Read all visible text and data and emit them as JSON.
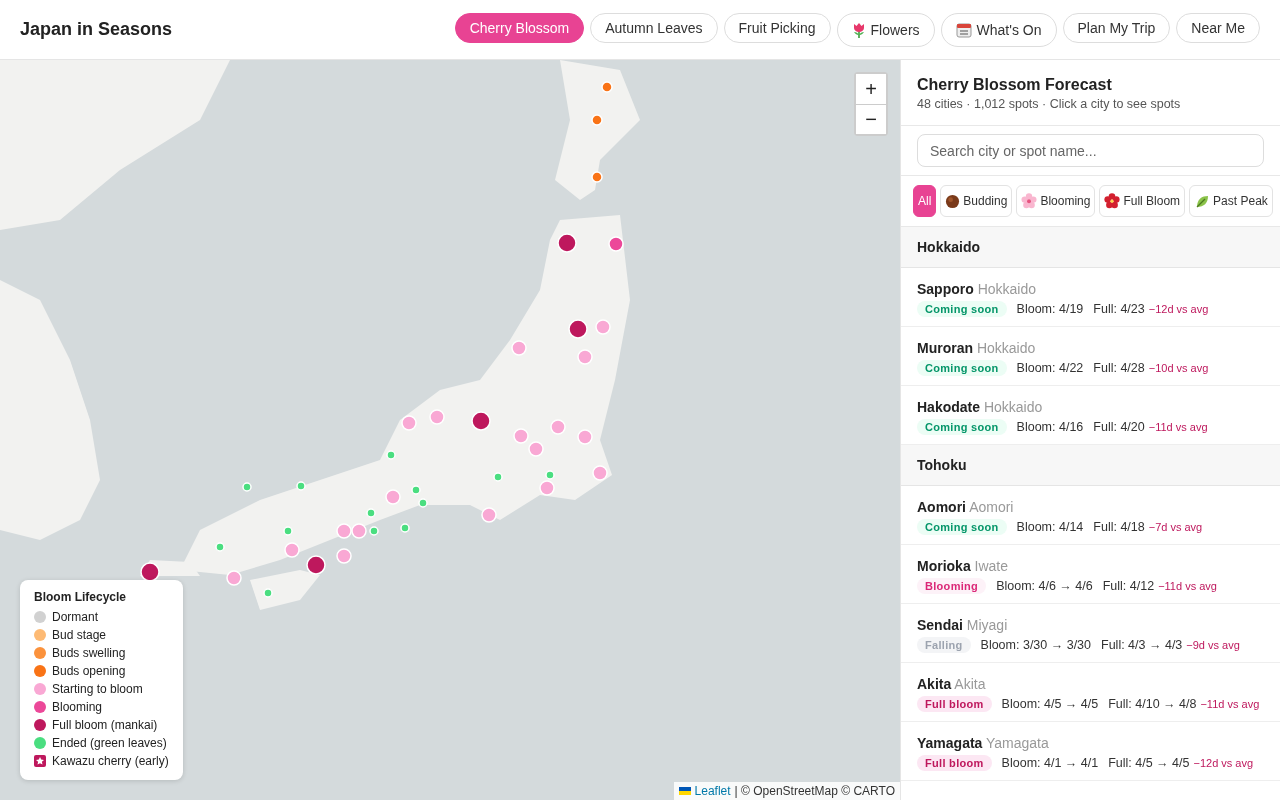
{
  "header": {
    "title": "Japan in Seasons",
    "nav": [
      {
        "label": "Cherry Blossom",
        "selected": true,
        "kind": "plain"
      },
      {
        "label": "Autumn Leaves",
        "selected": false,
        "kind": "plain"
      },
      {
        "label": "Fruit Picking",
        "selected": false,
        "kind": "plain"
      },
      {
        "label": "Flowers",
        "selected": false,
        "kind": "tulip"
      },
      {
        "label": "What's On",
        "selected": false,
        "kind": "calendar"
      },
      {
        "label": "Plan My Trip",
        "selected": false,
        "kind": "plain"
      },
      {
        "label": "Near Me",
        "selected": false,
        "kind": "plain"
      }
    ]
  },
  "map": {
    "zoom_in": "+",
    "zoom_out": "−",
    "legend": {
      "title": "Bloom Lifecycle",
      "items": [
        {
          "label": "Dormant",
          "color": "#d1d1d1",
          "kind": "dot"
        },
        {
          "label": "Bud stage",
          "color": "#fdba74",
          "kind": "dot"
        },
        {
          "label": "Buds swelling",
          "color": "#fb923c",
          "kind": "dot"
        },
        {
          "label": "Buds opening",
          "color": "#f97316",
          "kind": "dot"
        },
        {
          "label": "Starting to bloom",
          "color": "#f9a8d4",
          "kind": "dot"
        },
        {
          "label": "Blooming",
          "color": "#ec4899",
          "kind": "dot"
        },
        {
          "label": "Full bloom (mankai)",
          "color": "#be185d",
          "kind": "dot"
        },
        {
          "label": "Ended (green leaves)",
          "color": "#4ade80",
          "kind": "dot"
        },
        {
          "label": "Kawazu cherry (early)",
          "color": "#be185d",
          "kind": "star"
        }
      ]
    },
    "attribution": {
      "link": "Leaflet",
      "text": "| © OpenStreetMap © CARTO"
    }
  },
  "sidebar": {
    "title": "Cherry Blossom Forecast",
    "subtitle": "48 cities · 1,012 spots · Click a city to see spots",
    "search": {
      "placeholder": "Search city or spot name..."
    },
    "filters": [
      {
        "label": "All",
        "selected": true,
        "kind": "plain"
      },
      {
        "label": "Budding",
        "selected": false,
        "kind": "bud"
      },
      {
        "label": "Blooming",
        "selected": false,
        "kind": "blossom"
      },
      {
        "label": "Full Bloom",
        "selected": false,
        "kind": "hibiscus"
      },
      {
        "label": "Past Peak",
        "selected": false,
        "kind": "leaf"
      }
    ],
    "regions": [
      {
        "name": "Hokkaido",
        "cities": [
          {
            "city": "Sapporo",
            "prefecture": "Hokkaido",
            "status": "Coming soon",
            "kind": "soon",
            "bloom": "Bloom: 4/19",
            "full": "Full: 4/23",
            "diff": "−12d vs avg"
          },
          {
            "city": "Muroran",
            "prefecture": "Hokkaido",
            "status": "Coming soon",
            "kind": "soon",
            "bloom": "Bloom: 4/22",
            "full": "Full: 4/28",
            "diff": "−10d vs avg"
          },
          {
            "city": "Hakodate",
            "prefecture": "Hokkaido",
            "status": "Coming soon",
            "kind": "soon",
            "bloom": "Bloom: 4/16",
            "full": "Full: 4/20",
            "diff": "−11d vs avg"
          }
        ]
      },
      {
        "name": "Tohoku",
        "cities": [
          {
            "city": "Aomori",
            "prefecture": "Aomori",
            "status": "Coming soon",
            "kind": "soon",
            "bloom": "Bloom: 4/14",
            "full": "Full: 4/18",
            "diff": "−7d vs avg"
          },
          {
            "city": "Morioka",
            "prefecture": "Iwate",
            "status": "Blooming",
            "kind": "blooming",
            "bloom": "Bloom: 4/6 → 4/6",
            "full": "Full: 4/12",
            "diff": "−11d vs avg"
          },
          {
            "city": "Sendai",
            "prefecture": "Miyagi",
            "status": "Falling",
            "kind": "falling",
            "bloom": "Bloom: 3/30 → 3/30",
            "full": "Full: 4/3 → 4/3",
            "diff": "−9d vs avg"
          },
          {
            "city": "Akita",
            "prefecture": "Akita",
            "status": "Full bloom",
            "kind": "full",
            "bloom": "Bloom: 4/5 → 4/5",
            "full": "Full: 4/10 → 4/8",
            "diff": "−11d vs avg"
          },
          {
            "city": "Yamagata",
            "prefecture": "Yamagata",
            "status": "Full bloom",
            "kind": "full",
            "bloom": "Bloom: 4/1 → 4/1",
            "full": "Full: 4/5 → 4/5",
            "diff": "−12d vs avg"
          }
        ]
      }
    ]
  }
}
